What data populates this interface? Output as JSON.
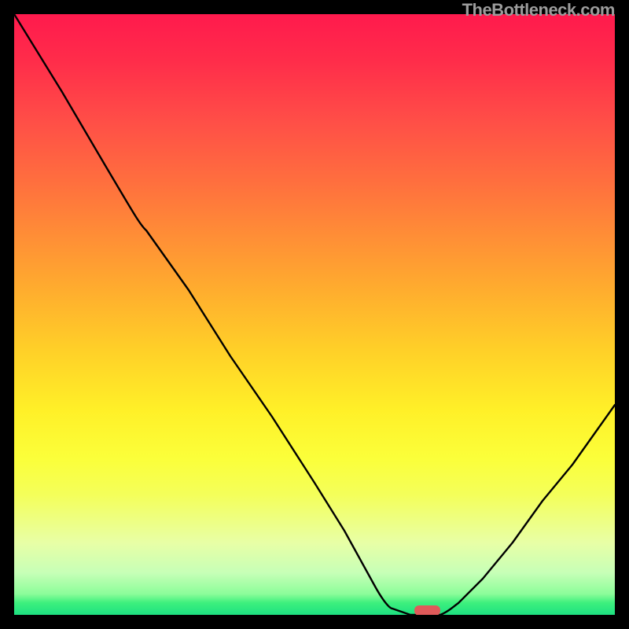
{
  "watermark": "TheBottleneck.com",
  "chart_data": {
    "type": "line",
    "title": "",
    "xlabel": "",
    "ylabel": "",
    "x_range": [
      0,
      100
    ],
    "y_range": [
      0,
      100
    ],
    "grid": false,
    "legend": false,
    "background": {
      "description": "vertical rainbow gradient red->yellow->green indicating bottleneck severity",
      "high_color": "#ff1a4d",
      "mid_color": "#fff028",
      "low_color": "#1de181"
    },
    "series": [
      {
        "name": "bottleneck-curve",
        "color": "#000000",
        "x": [
          0,
          8,
          15,
          22,
          29,
          36,
          43,
          50,
          55,
          60,
          63,
          66,
          69,
          71,
          74,
          78,
          83,
          88,
          93,
          100
        ],
        "values": [
          100,
          87,
          75,
          64,
          54,
          43,
          33,
          22,
          14,
          5,
          1,
          0,
          0,
          0,
          2,
          6,
          12,
          19,
          25,
          35
        ]
      }
    ],
    "marker": {
      "name": "optimal-point",
      "x": 68.5,
      "y": 0,
      "color": "#e05a5a",
      "shape": "rounded-rect"
    }
  }
}
